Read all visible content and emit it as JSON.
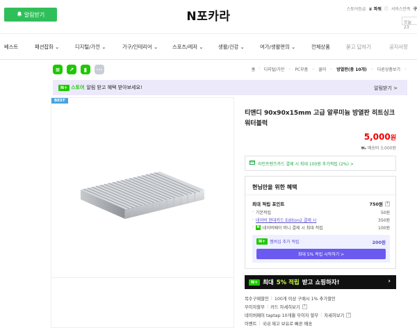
{
  "header": {
    "alarm_button": "알림받기",
    "logo": "N포카라",
    "util_items": [
      "스토어등급",
      "파워",
      "서비스만족",
      "구"
    ],
    "today": "오늘 23"
  },
  "nav": {
    "items": [
      "베스트",
      "패션잡화",
      "디지털/가전",
      "가구/인테리어",
      "스포츠/레저",
      "생활/건강",
      "여가/생활편의",
      "전체상품",
      "묻고 답하기",
      "공지사항"
    ]
  },
  "breadcrumb": [
    "홈",
    "디지털/가전",
    "PC부품",
    "쿨러",
    "방열판(총 10개)",
    "다른상품보기"
  ],
  "banner": {
    "tag": "N+",
    "store_word": "스토어",
    "text": "알림 받고 혜택 받아보세요!",
    "right": "알림받기 >"
  },
  "badge": "BEST",
  "product": {
    "title": "티앤디 90x90x15mm 고급 알루미늄 방열판 히트싱크 워터블럭",
    "price": "5,000",
    "won": "원",
    "shipping": "배송비 3,000원"
  },
  "card_promo": "라인프렌즈카드 결제 시 최대 100원 추가적립 (2%) >",
  "benefit": {
    "title": "현님만을 위한 혜택",
    "max_label": "최대 적립 포인트",
    "max_value": "750원",
    "rows": [
      {
        "label": "기본적립",
        "value": "50원"
      },
      {
        "label": "네이버 현대카드 Edition2 결제 시",
        "value": "350원"
      },
      {
        "label": "네이버페이 머니 결제 시 최대 적립",
        "value": "100원"
      }
    ],
    "member_label": "멤버십 추가 적립",
    "member_value": "200원",
    "member_button": "최대 5% 적립 시작하기 >"
  },
  "dark_banner": {
    "tag": "N+",
    "prefix": "최대",
    "highlight": "5% 적립",
    "suffix": "받고 쇼핑하자!"
  },
  "info_rows": [
    {
      "label": "복수구매할인",
      "value": "100개 이상 구매시 1% 추가할인"
    },
    {
      "label": "무이자할부",
      "value": "카드 자세히보기"
    },
    {
      "label": "네이버페이 taptap 10개월 무이자 할부",
      "value": "자세히보기"
    },
    {
      "label": "이벤트",
      "value": "국내 재고 보유로 빠른 배송"
    }
  ],
  "colors": {
    "green": "#2fbf5a",
    "naver_green": "#1ec800",
    "price_red": "#e00000",
    "purple": "#6b5af0"
  }
}
